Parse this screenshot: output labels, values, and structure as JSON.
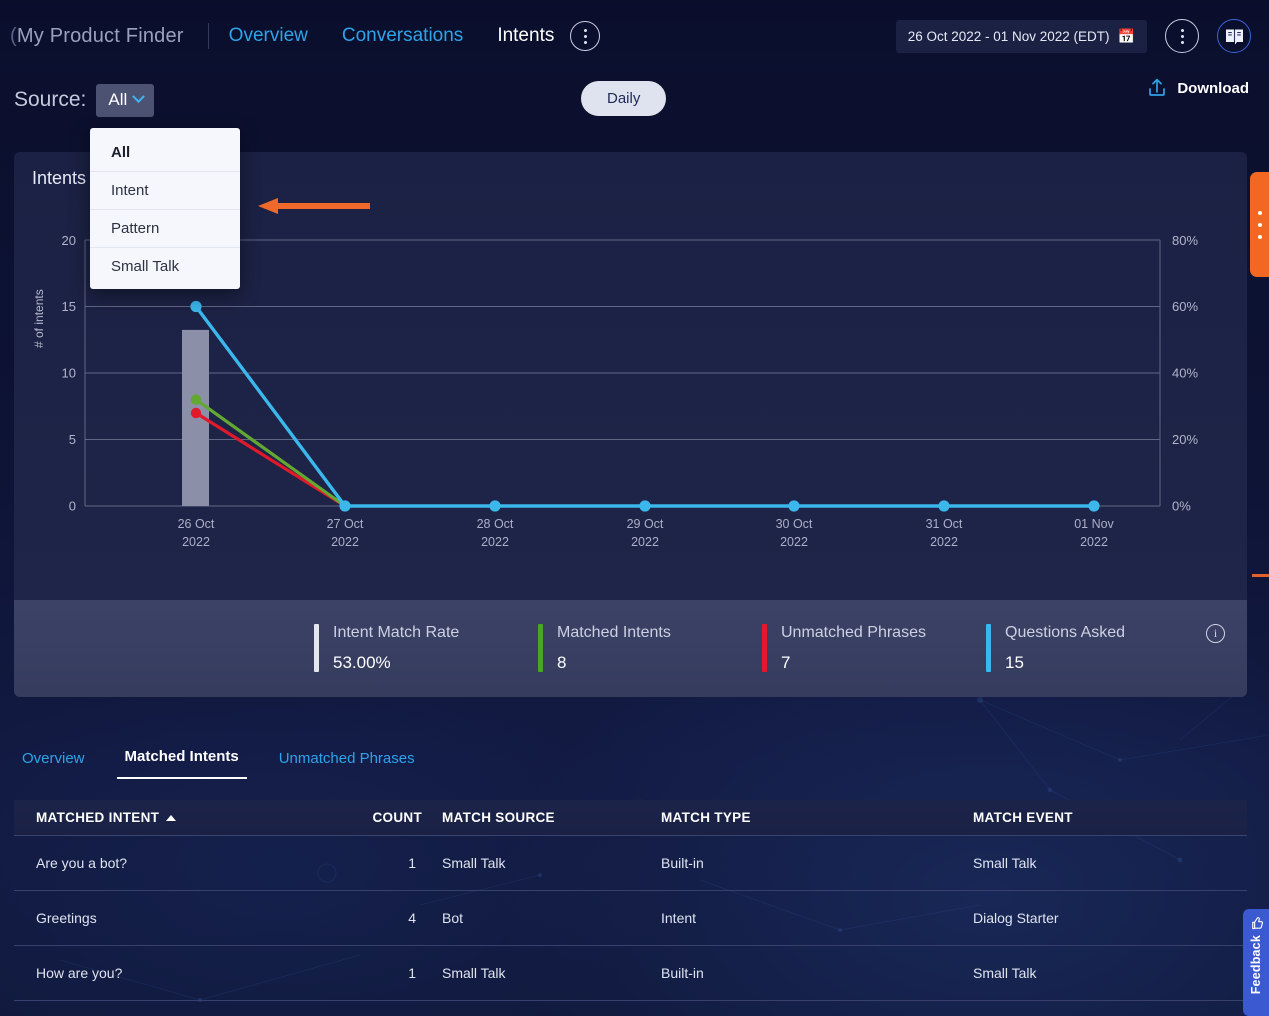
{
  "header": {
    "brand": "My Product Finder",
    "nav": [
      {
        "label": "Overview",
        "active": false
      },
      {
        "label": "Conversations",
        "active": false
      },
      {
        "label": "Intents",
        "active": true
      }
    ],
    "kebab_icon": "kebab-menu-icon",
    "date_range": "26 Oct 2022 - 01 Nov 2022 (EDT)",
    "calendar_icon": "calendar-icon",
    "more_icon": "kebab-menu-icon",
    "guide_icon": "book-icon"
  },
  "toolbar": {
    "source_label": "Source:",
    "source_value": "All",
    "chevron_icon": "chevron-down-icon",
    "granularity": "Daily",
    "download_label": "Download",
    "download_icon": "upload-icon"
  },
  "dropdown": {
    "open": true,
    "items": [
      {
        "label": "All",
        "selected": true
      },
      {
        "label": "Intent",
        "selected": false
      },
      {
        "label": "Pattern",
        "selected": false
      },
      {
        "label": "Small Talk",
        "selected": false
      }
    ]
  },
  "chart_data": {
    "type": "line",
    "title": "Intents",
    "xlabel": "",
    "ylabel": "# of intents",
    "categories": [
      "26 Oct\n2022",
      "27 Oct\n2022",
      "28 Oct\n2022",
      "29 Oct\n2022",
      "30 Oct\n2022",
      "31 Oct\n2022",
      "01 Nov\n2022"
    ],
    "x_tick_day": [
      "26 Oct",
      "27 Oct",
      "28 Oct",
      "29 Oct",
      "30 Oct",
      "31 Oct",
      "01 Nov"
    ],
    "x_tick_year": [
      "2022",
      "2022",
      "2022",
      "2022",
      "2022",
      "2022",
      "2022"
    ],
    "ylim": [
      0,
      20
    ],
    "y_ticks": [
      0,
      5,
      10,
      15,
      20
    ],
    "y2lim": [
      0,
      80
    ],
    "y2_ticks": [
      "0%",
      "20%",
      "40%",
      "60%",
      "80%"
    ],
    "grid": true,
    "legend": "none",
    "series": [
      {
        "name": "Questions Asked",
        "type": "line",
        "color": "#3cb7ec",
        "axis": "left",
        "values": [
          15,
          0,
          0,
          0,
          0,
          0,
          0
        ]
      },
      {
        "name": "Matched Intents",
        "type": "line",
        "color": "#63a832",
        "axis": "left",
        "values": [
          8,
          0,
          null,
          null,
          null,
          null,
          null
        ]
      },
      {
        "name": "Unmatched Phrases",
        "type": "line",
        "color": "#e01a2b",
        "axis": "left",
        "values": [
          7,
          0,
          null,
          null,
          null,
          null,
          null
        ]
      },
      {
        "name": "Intent Match Rate",
        "type": "bar",
        "color": "#8b90a8",
        "axis": "right",
        "values": [
          53,
          0,
          0,
          0,
          0,
          0,
          0
        ]
      }
    ]
  },
  "stats": [
    {
      "label": "Intent Match Rate",
      "value": "53.00%",
      "color": "#e3e6ef"
    },
    {
      "label": "Matched Intents",
      "value": "8",
      "color": "#4ca427"
    },
    {
      "label": "Unmatched Phrases",
      "value": "7",
      "color": "#e5172f"
    },
    {
      "label": "Questions Asked",
      "value": "15",
      "color": "#3cb7ec"
    }
  ],
  "stats_info_icon": "info-icon",
  "tabs": [
    {
      "label": "Overview",
      "active": false
    },
    {
      "label": "Matched Intents",
      "active": true
    },
    {
      "label": "Unmatched Phrases",
      "active": false
    }
  ],
  "table": {
    "columns": [
      "MATCHED INTENT",
      "COUNT",
      "MATCH SOURCE",
      "MATCH TYPE",
      "MATCH EVENT"
    ],
    "sort_column": "MATCHED INTENT",
    "sort_direction": "asc",
    "sort_icon": "caret-up-icon",
    "rows": [
      {
        "intent": "Are you a bot?",
        "count": "1",
        "source": "Small Talk",
        "type": "Built-in",
        "event": "Small Talk"
      },
      {
        "intent": "Greetings",
        "count": "4",
        "source": "Bot",
        "type": "Intent",
        "event": "Dialog Starter"
      },
      {
        "intent": "How are you?",
        "count": "1",
        "source": "Small Talk",
        "type": "Built-in",
        "event": "Small Talk"
      }
    ]
  },
  "side_widgets": {
    "orange_tab_icon": "kebab-menu-icon",
    "feedback_label": "Feedback",
    "feedback_icon": "thumbs-up-icon"
  },
  "annotation": {
    "arrow_color": "#ef6a2a",
    "arrow_icon": "left-arrow-annotation"
  }
}
